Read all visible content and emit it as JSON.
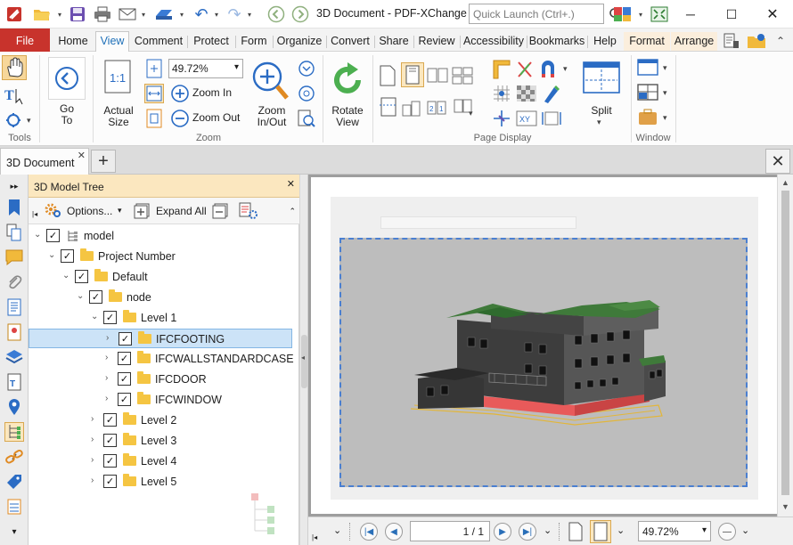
{
  "app": {
    "title": "3D Document - PDF-XChange ...",
    "quick_launch_placeholder": "Quick Launch (Ctrl+.)"
  },
  "tabs": {
    "file": "File",
    "items": [
      "Home",
      "View",
      "Comment",
      "Protect",
      "Form",
      "Organize",
      "Convert",
      "Share",
      "Review",
      "Accessibility",
      "Bookmarks",
      "Help",
      "Format",
      "Arrange"
    ],
    "active": "View"
  },
  "ribbon": {
    "tools_group": "Tools",
    "zoom_group": "Zoom",
    "page_display_group": "Page Display",
    "window_group": "Window",
    "go_to": "Go\nTo",
    "actual_size": "Actual\nSize",
    "zoom_value": "49.72%",
    "zoom_in": "Zoom In",
    "zoom_out": "Zoom Out",
    "zoom_in_out": "Zoom\nIn/Out",
    "rotate_view": "Rotate\nView",
    "split": "Split"
  },
  "document_tab": {
    "label": "3D Document"
  },
  "model_tree": {
    "title": "3D Model Tree",
    "options": "Options...",
    "expand_all": "Expand All",
    "rows": [
      {
        "label": "model",
        "level": 0,
        "expanded": true,
        "folder": false,
        "selected": false
      },
      {
        "label": "Project Number",
        "level": 1,
        "expanded": true,
        "folder": true,
        "selected": false
      },
      {
        "label": "Default",
        "level": 2,
        "expanded": true,
        "folder": true,
        "selected": false
      },
      {
        "label": "node",
        "level": 3,
        "expanded": true,
        "folder": true,
        "selected": false
      },
      {
        "label": "Level 1",
        "level": 4,
        "expanded": true,
        "folder": true,
        "selected": false
      },
      {
        "label": "IFCFOOTING",
        "level": 5,
        "expanded": false,
        "folder": true,
        "selected": true
      },
      {
        "label": "IFCWALLSTANDARDCASE",
        "level": 5,
        "expanded": false,
        "folder": true,
        "selected": false
      },
      {
        "label": "IFCDOOR",
        "level": 5,
        "expanded": false,
        "folder": true,
        "selected": false
      },
      {
        "label": "IFCWINDOW",
        "level": 5,
        "expanded": false,
        "folder": true,
        "selected": false
      },
      {
        "label": "Level 2",
        "level": 4,
        "expanded": false,
        "folder": true,
        "selected": false
      },
      {
        "label": "Level 3",
        "level": 4,
        "expanded": false,
        "folder": true,
        "selected": false
      },
      {
        "label": "Level 4",
        "level": 4,
        "expanded": false,
        "folder": true,
        "selected": false
      },
      {
        "label": "Level 5",
        "level": 4,
        "expanded": false,
        "folder": true,
        "selected": false
      }
    ]
  },
  "status": {
    "page_current": "1",
    "page_total": "1",
    "page_display": "1 / 1",
    "zoom": "49.72%"
  },
  "colors": {
    "file_tab": "#c8332c",
    "panel_header": "#fbe7bf",
    "selection": "#cce3f7",
    "accent": "#1d6fb8"
  }
}
